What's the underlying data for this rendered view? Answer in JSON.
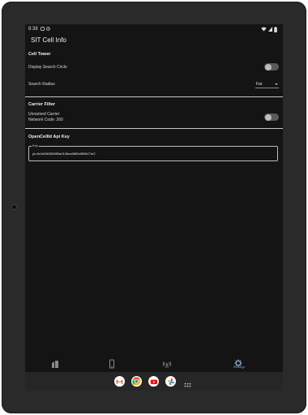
{
  "status_bar": {
    "time": "8:38"
  },
  "app": {
    "title": "SIT Cell Info"
  },
  "sections": {
    "cell_tower": {
      "title": "Cell Tower",
      "display_search_circle": "Display Search Circle",
      "search_radius_label": "Search Radius",
      "search_radius_value": "Far"
    },
    "carrier_filter": {
      "title": "Carrier Filter",
      "unnamed_carrier_line1": "Unnamed Carrier",
      "unnamed_carrier_line2": "Network Code: 260"
    },
    "opencellid": {
      "title": "OpenCellId Api Key",
      "key_label": "Key",
      "key_value": "pk.6e1b080356f55a0106ea3865d983b71e2"
    }
  },
  "bottom_nav": {
    "settings_label": "Settings"
  },
  "colors": {
    "background": "#141414",
    "accent": "#7fa2c8",
    "toggle_track": "#5a5a5a",
    "divider": "#c8c8c8"
  },
  "taskbar_apps": [
    "gmail-icon",
    "chrome-icon",
    "youtube-icon",
    "photos-icon",
    "app-drawer-icon"
  ]
}
